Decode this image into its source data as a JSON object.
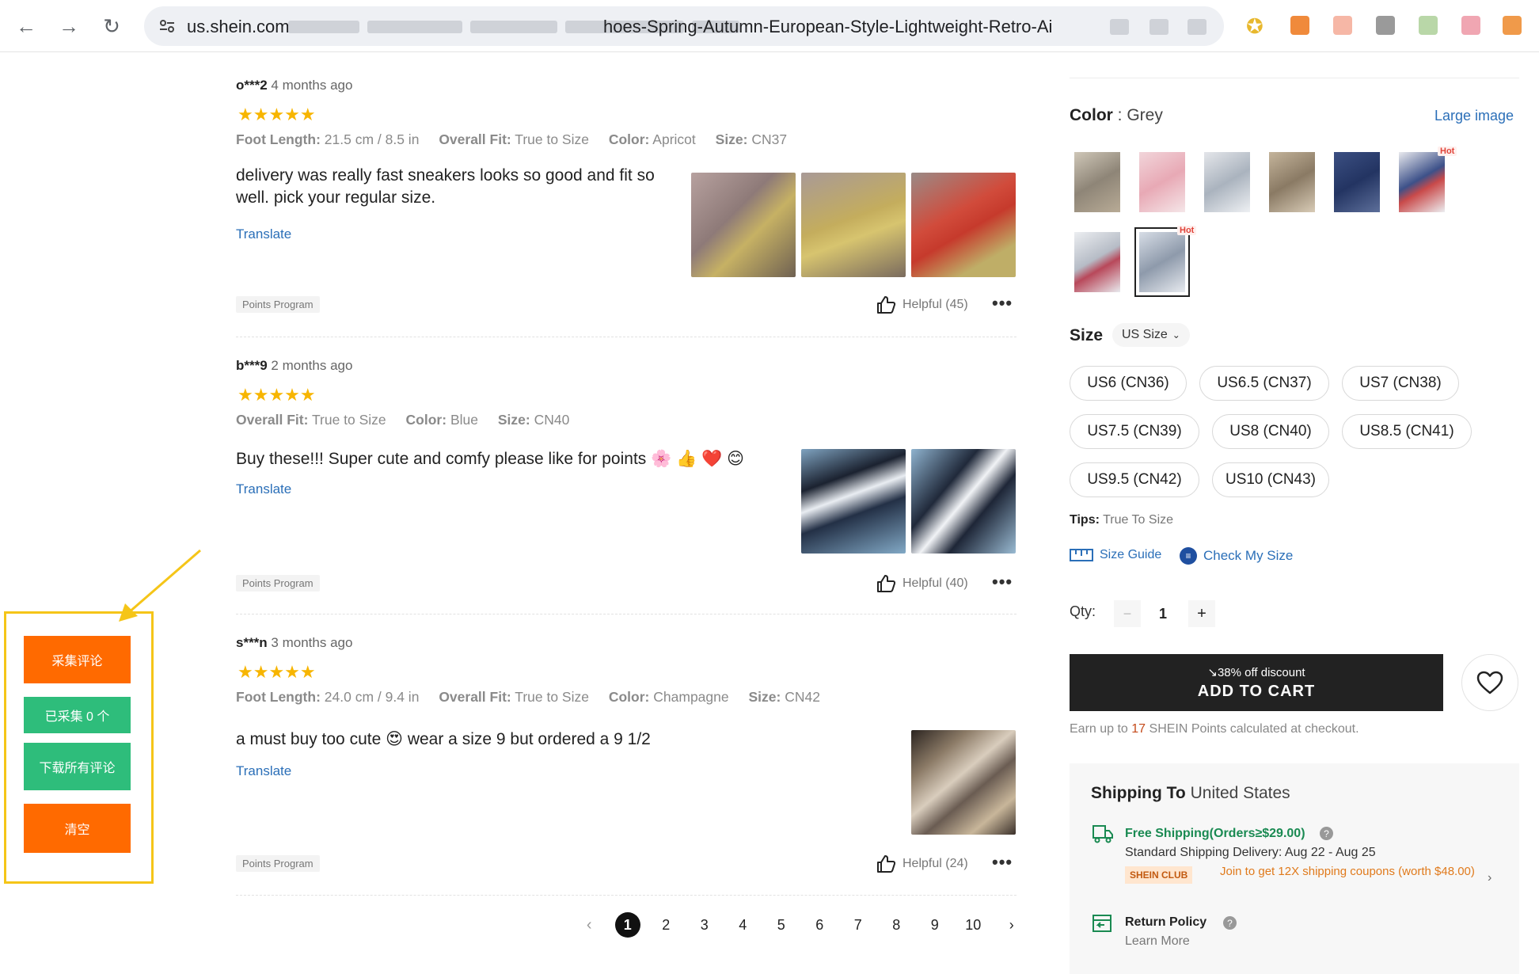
{
  "browser": {
    "url_start": "us.shein.com",
    "url_end": "hoes-Spring-Autumn-European-Style-Lightweight-Retro-Ai"
  },
  "colors": {
    "accent_orange": "#ff6a00",
    "accent_green": "#2ebd7b",
    "plugin_border": "#f5c518",
    "link_blue": "#2b6fb8",
    "star": "#f7b500",
    "cta": "#222222"
  },
  "reviews": [
    {
      "user": "o***2",
      "time": "4 months ago",
      "stars": "★★★★★",
      "meta": [
        {
          "k": "Foot Length:",
          "v": "21.5 cm / 8.5 in"
        },
        {
          "k": "Overall Fit:",
          "v": "True to Size"
        },
        {
          "k": "Color:",
          "v": "Apricot"
        },
        {
          "k": "Size:",
          "v": "CN37"
        }
      ],
      "text": "delivery was really fast sneakers looks so good and fit so well. pick your regular size.",
      "translate": "Translate",
      "points": "Points Program",
      "helpful": "Helpful (45)",
      "more": "•••"
    },
    {
      "user": "b***9",
      "time": "2 months ago",
      "stars": "★★★★★",
      "meta": [
        {
          "k": "Overall Fit:",
          "v": "True to Size"
        },
        {
          "k": "Color:",
          "v": "Blue"
        },
        {
          "k": "Size:",
          "v": "CN40"
        }
      ],
      "text": "Buy these!!! Super cute and comfy please like for points 🌸 👍 ❤️ 😊",
      "translate": "Translate",
      "points": "Points Program",
      "helpful": "Helpful (40)",
      "more": "•••"
    },
    {
      "user": "s***n",
      "time": "3 months ago",
      "stars": "★★★★★",
      "meta": [
        {
          "k": "Foot Length:",
          "v": "24.0 cm / 9.4 in"
        },
        {
          "k": "Overall Fit:",
          "v": "True to Size"
        },
        {
          "k": "Color:",
          "v": "Champagne"
        },
        {
          "k": "Size:",
          "v": "CN42"
        }
      ],
      "text": "a must buy too cute 😍 wear a size 9 but ordered a 9 1/2",
      "translate": "Translate",
      "points": "Points Program",
      "helpful": "Helpful (24)",
      "more": "•••"
    }
  ],
  "pagination": {
    "prev": "‹",
    "next": "›",
    "pages": [
      "1",
      "2",
      "3",
      "4",
      "5",
      "6",
      "7",
      "8",
      "9",
      "10"
    ],
    "current": "1"
  },
  "plugin": {
    "collect": "采集评论",
    "collected": "已采集 0 个",
    "download": "下载所有评论",
    "clear": "清空"
  },
  "product": {
    "color_label": "Color",
    "color_value": ": Grey",
    "large_image": "Large image",
    "hot_label": "Hot",
    "size_label": "Size",
    "size_system": "US Size",
    "sizes": [
      "US6 (CN36)",
      "US6.5 (CN37)",
      "US7 (CN38)",
      "US7.5 (CN39)",
      "US8 (CN40)",
      "US8.5 (CN41)",
      "US9.5 (CN42)",
      "US10 (CN43)"
    ],
    "tips_label": "Tips:",
    "tips_value": "True To Size",
    "size_guide": "Size Guide",
    "check_size": "Check My Size",
    "qty_label": "Qty:",
    "qty_minus": "−",
    "qty_value": "1",
    "qty_plus": "+",
    "discount": "↘38% off discount",
    "add_to_cart": "ADD TO CART",
    "earn_prefix": "Earn up to ",
    "earn_points": "17",
    "earn_suffix": " SHEIN Points calculated at checkout."
  },
  "shipping": {
    "title": "Shipping To",
    "country": "United States",
    "free_label": "Free Shipping(Orders≥$29.00)",
    "standard": "Standard Shipping Delivery: Aug 22 - Aug 25",
    "club": "SHEIN CLUB",
    "club_offer": "Join to get 12X shipping coupons (worth $48.00)",
    "return_title": "Return Policy",
    "return_link": "Learn More"
  }
}
